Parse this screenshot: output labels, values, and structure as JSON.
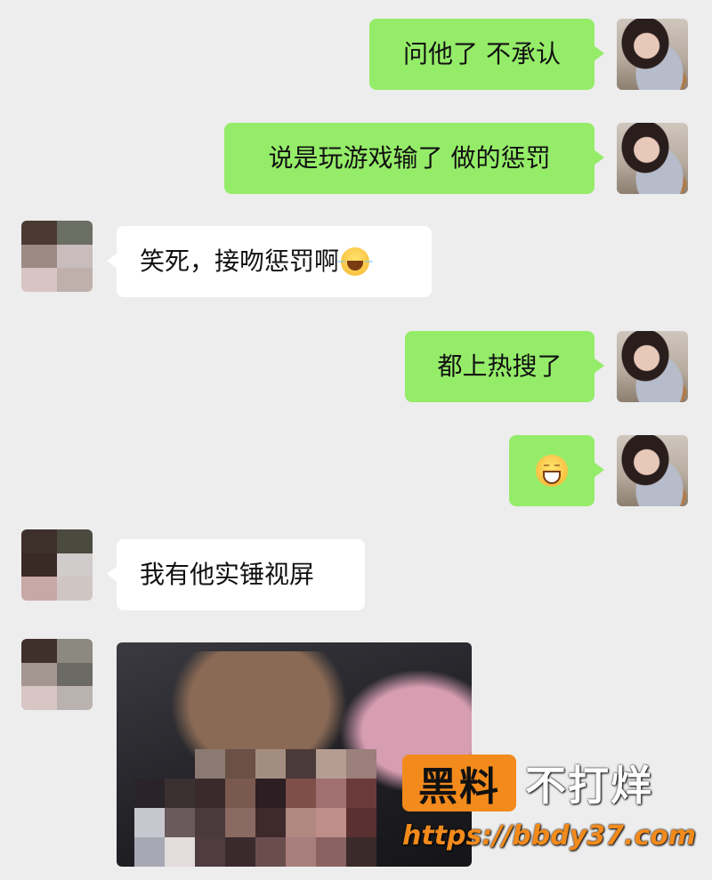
{
  "messages": [
    {
      "sender": "self",
      "text": "问他了 不承认"
    },
    {
      "sender": "self",
      "text": "说是玩游戏输了 做的惩罚"
    },
    {
      "sender": "other",
      "text": "笑死，接吻惩罚啊",
      "emoji": "face-with-tears-of-joy"
    },
    {
      "sender": "self",
      "text": "都上热搜了"
    },
    {
      "sender": "self",
      "text": "",
      "emoji": "grinning-face-with-smiling-eyes"
    },
    {
      "sender": "other",
      "text": "我有他实锤视屏"
    },
    {
      "sender": "other",
      "type": "image",
      "description": "blurred screenshot"
    }
  ],
  "watermark": {
    "badge": "黑料",
    "text": "不打烊",
    "url": "https://bbdy37.com"
  },
  "colors": {
    "background": "#ededed",
    "self_bubble": "#95ec69",
    "other_bubble": "#ffffff",
    "watermark_accent": "#f28a1c"
  }
}
